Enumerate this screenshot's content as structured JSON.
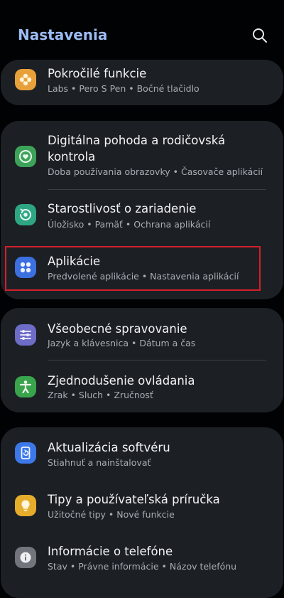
{
  "header": {
    "title": "Nastavenia",
    "search_icon": "search-icon"
  },
  "card1": {
    "items": [
      {
        "title": "Pokročilé funkcie",
        "subtitle": "Labs  •  Pero S Pen  •  Bočné tlačidlo",
        "icon": "advanced-features-icon",
        "color": "#e8a13a"
      }
    ]
  },
  "card2": {
    "items": [
      {
        "title_line1": "Digitálna pohoda a rodičovská",
        "title_line2": "kontrola",
        "subtitle": "Doba používania obrazovky  •  Časovače aplikácií",
        "icon": "digital-wellbeing-icon",
        "color": "#3da35a"
      },
      {
        "title": "Starostlivosť o zariadenie",
        "subtitle": "Úložisko  •  Pamäť  •  Ochrana aplikácií",
        "icon": "device-care-icon",
        "color": "#2ea683"
      },
      {
        "title": "Aplikácie",
        "subtitle": "Predvolené aplikácie  •  Nastavenia aplikácií",
        "icon": "apps-icon",
        "color": "#3c6fe0"
      }
    ]
  },
  "card3": {
    "items": [
      {
        "title": "Všeobecné spravovanie",
        "subtitle": "Jazyk a klávesnica  •  Dátum a čas",
        "icon": "sliders-icon",
        "color": "#6d6cc6"
      },
      {
        "title": "Zjednodušenie ovládania",
        "subtitle": "Zrak  •  Sluch  •  Zručnosť",
        "icon": "accessibility-icon",
        "color": "#3aa44d"
      }
    ]
  },
  "card4": {
    "items": [
      {
        "title": "Aktualizácia softvéru",
        "subtitle": "Stiahnuť a nainštalovať",
        "icon": "software-update-icon",
        "color": "#3c78e8"
      },
      {
        "title": "Tipy a používateľská príručka",
        "subtitle": "Užitočné tipy  •  Nové funkcie",
        "icon": "tips-lightbulb-icon",
        "color": "#e6ad2c"
      },
      {
        "title": "Informácie o telefóne",
        "subtitle": "Stav  •  Právne informácie  •  Názov telefónu",
        "icon": "info-icon",
        "color": "#72757c"
      }
    ]
  },
  "colors": {
    "background": "#010203",
    "card": "#1c2025",
    "header_title": "#9cbcf5",
    "highlight_border": "#d51f2a"
  }
}
